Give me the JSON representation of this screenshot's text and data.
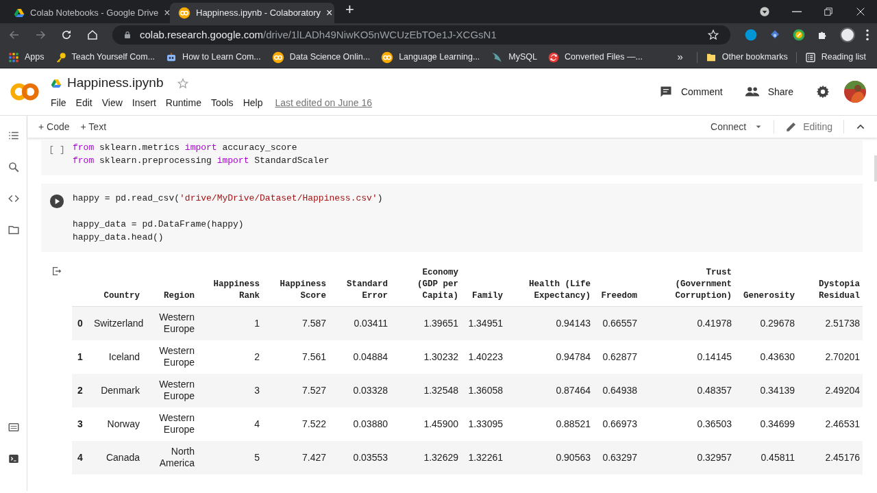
{
  "browser": {
    "tabs": [
      {
        "title": "Colab Notebooks - Google Drive",
        "close": "×",
        "selected": false,
        "kind": "drive"
      },
      {
        "title": "Happiness.ipynb - Colaboratory",
        "close": "×",
        "selected": true,
        "kind": "colab"
      }
    ],
    "new_tab": "+",
    "url": {
      "host": "colab.research.google.com",
      "path": "/drive/1lLADh49NiwKO5nWCUzEbTOe1J-XCGsN1"
    },
    "bookmarks": [
      {
        "label": "Apps",
        "kind": "apps"
      },
      {
        "label": "Teach Yourself Com...",
        "kind": "key"
      },
      {
        "label": "How to Learn Com...",
        "kind": "bot"
      },
      {
        "label": "Data Science Onlin...",
        "kind": "colab"
      },
      {
        "label": "Language Learning...",
        "kind": "colab"
      },
      {
        "label": "MySQL",
        "kind": "dolphin"
      },
      {
        "label": "Converted Files —...",
        "kind": "convert"
      }
    ],
    "more_bookmarks": "»",
    "bookmarks_right": [
      {
        "label": "Other bookmarks",
        "kind": "folder"
      },
      {
        "label": "Reading list",
        "kind": "list"
      }
    ]
  },
  "notebook": {
    "title": "Happiness.ipynb",
    "menu": [
      "File",
      "Edit",
      "View",
      "Insert",
      "Runtime",
      "Tools",
      "Help"
    ],
    "last_edited": "Last edited on June 16",
    "actions": [
      "Comment",
      "Share"
    ],
    "toolbar": {
      "add": [
        "+ Code",
        "+ Text"
      ],
      "connect": "Connect",
      "mode": "Editing"
    },
    "cells": [
      {
        "kind": "prompt",
        "prompt": "[ ]",
        "code": [
          {
            "kind": "keyword",
            "text": "from"
          },
          {
            "kind": "plain",
            "text": " sklearn.metrics "
          },
          {
            "kind": "keyword",
            "text": "import"
          },
          {
            "kind": "plain",
            "text": " accuracy_score\n"
          },
          {
            "kind": "keyword",
            "text": "from"
          },
          {
            "kind": "plain",
            "text": " sklearn.preprocessing "
          },
          {
            "kind": "keyword",
            "text": "import"
          },
          {
            "kind": "plain",
            "text": " StandardScaler"
          }
        ]
      },
      {
        "kind": "run_button",
        "code": [
          {
            "kind": "plain",
            "text": "happy = pd.read_csv("
          },
          {
            "kind": "string",
            "text": "'drive/MyDrive/Dataset/Happiness.csv'"
          },
          {
            "kind": "plain",
            "text": ")\n\nhappy_data = pd.DataFrame(happy)\nhappy_data.head()"
          }
        ]
      }
    ],
    "output": {
      "table": {
        "columns": [
          "",
          "Country",
          "Region",
          "Happiness Rank",
          "Happiness Score",
          "Standard Error",
          "Economy (GDP per Capita)",
          "Family",
          "Health (Life Expectancy)",
          "Freedom",
          "Trust (Government Corruption)",
          "Generosity",
          "Dystopia Residual"
        ],
        "rows": [
          [
            "0",
            "Switzerland",
            "Western Europe",
            "1",
            "7.587",
            "0.03411",
            "1.39651",
            "1.34951",
            "0.94143",
            "0.66557",
            "0.41978",
            "0.29678",
            "2.51738"
          ],
          [
            "1",
            "Iceland",
            "Western Europe",
            "2",
            "7.561",
            "0.04884",
            "1.30232",
            "1.40223",
            "0.94784",
            "0.62877",
            "0.14145",
            "0.43630",
            "2.70201"
          ],
          [
            "2",
            "Denmark",
            "Western Europe",
            "3",
            "7.527",
            "0.03328",
            "1.32548",
            "1.36058",
            "0.87464",
            "0.64938",
            "0.48357",
            "0.34139",
            "2.49204"
          ],
          [
            "3",
            "Norway",
            "Western Europe",
            "4",
            "7.522",
            "0.03880",
            "1.45900",
            "1.33095",
            "0.88521",
            "0.66973",
            "0.36503",
            "0.34699",
            "2.46531"
          ],
          [
            "4",
            "Canada",
            "North America",
            "5",
            "7.427",
            "0.03553",
            "1.32629",
            "1.32261",
            "0.90563",
            "0.63297",
            "0.32957",
            "0.45811",
            "2.45176"
          ]
        ]
      }
    }
  }
}
